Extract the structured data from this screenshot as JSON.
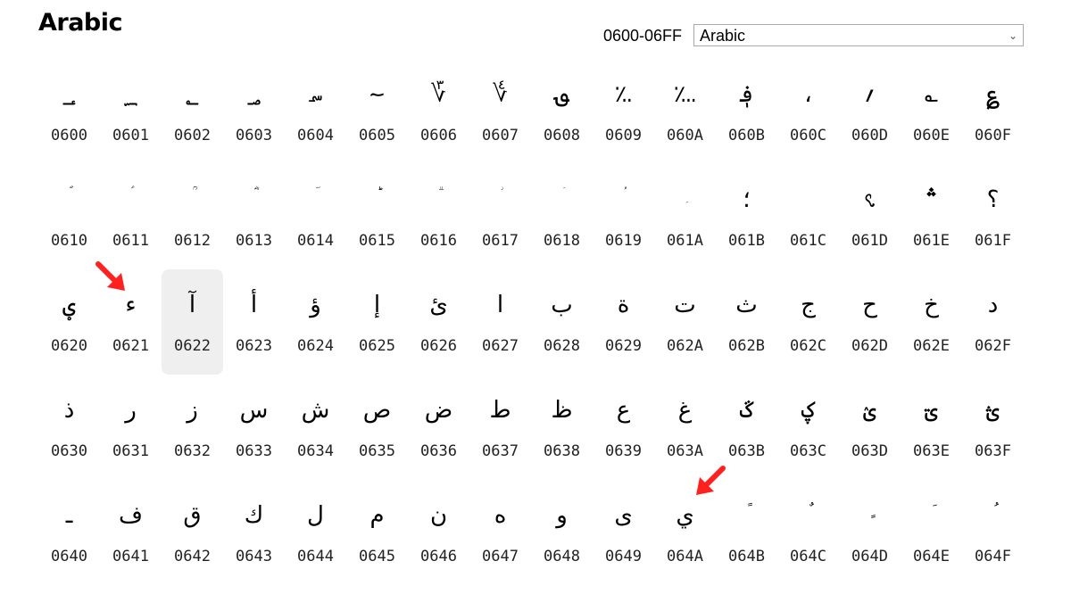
{
  "header": {
    "title": "Arabic",
    "range": "0600-06FF",
    "block_select": {
      "selected": "Arabic"
    }
  },
  "grid": {
    "selected_code": "0622",
    "rows": [
      [
        {
          "ch": "؀",
          "code": "0600"
        },
        {
          "ch": "؁",
          "code": "0601"
        },
        {
          "ch": "؂",
          "code": "0602"
        },
        {
          "ch": "؃",
          "code": "0603"
        },
        {
          "ch": "؄",
          "code": "0604"
        },
        {
          "ch": "؅",
          "code": "0605"
        },
        {
          "ch": "؆",
          "code": "0606"
        },
        {
          "ch": "؇",
          "code": "0607"
        },
        {
          "ch": "؈",
          "code": "0608"
        },
        {
          "ch": "؉",
          "code": "0609"
        },
        {
          "ch": "؊",
          "code": "060A"
        },
        {
          "ch": "؋",
          "code": "060B"
        },
        {
          "ch": "،",
          "code": "060C"
        },
        {
          "ch": "؍",
          "code": "060D"
        },
        {
          "ch": "؎",
          "code": "060E"
        },
        {
          "ch": "؏",
          "code": "060F"
        }
      ],
      [
        {
          "ch": "ؐ",
          "code": "0610",
          "small": true
        },
        {
          "ch": "ؑ",
          "code": "0611",
          "small": true
        },
        {
          "ch": "ؒ",
          "code": "0612",
          "small": true
        },
        {
          "ch": "ؓ",
          "code": "0613",
          "small": true
        },
        {
          "ch": "ؔ",
          "code": "0614",
          "small": true
        },
        {
          "ch": "ؕ",
          "code": "0615",
          "small": true
        },
        {
          "ch": "ؖ",
          "code": "0616",
          "small": true
        },
        {
          "ch": "ؗ",
          "code": "0617",
          "small": true
        },
        {
          "ch": "ؘ",
          "code": "0618",
          "small": true
        },
        {
          "ch": "ؙ",
          "code": "0619",
          "small": true
        },
        {
          "ch": "ؚ",
          "code": "061A",
          "small": true
        },
        {
          "ch": "؛",
          "code": "061B"
        },
        {
          "ch": "",
          "code": "061C"
        },
        {
          "ch": "؝",
          "code": "061D"
        },
        {
          "ch": "؞",
          "code": "061E"
        },
        {
          "ch": "؟",
          "code": "061F"
        }
      ],
      [
        {
          "ch": "ؠ",
          "code": "0620"
        },
        {
          "ch": "ء",
          "code": "0621"
        },
        {
          "ch": "آ",
          "code": "0622"
        },
        {
          "ch": "أ",
          "code": "0623"
        },
        {
          "ch": "ؤ",
          "code": "0624"
        },
        {
          "ch": "إ",
          "code": "0625"
        },
        {
          "ch": "ئ",
          "code": "0626"
        },
        {
          "ch": "ا",
          "code": "0627"
        },
        {
          "ch": "ب",
          "code": "0628"
        },
        {
          "ch": "ة",
          "code": "0629"
        },
        {
          "ch": "ت",
          "code": "062A"
        },
        {
          "ch": "ث",
          "code": "062B"
        },
        {
          "ch": "ج",
          "code": "062C"
        },
        {
          "ch": "ح",
          "code": "062D"
        },
        {
          "ch": "خ",
          "code": "062E"
        },
        {
          "ch": "د",
          "code": "062F"
        }
      ],
      [
        {
          "ch": "ذ",
          "code": "0630"
        },
        {
          "ch": "ر",
          "code": "0631"
        },
        {
          "ch": "ز",
          "code": "0632"
        },
        {
          "ch": "س",
          "code": "0633"
        },
        {
          "ch": "ش",
          "code": "0634"
        },
        {
          "ch": "ص",
          "code": "0635"
        },
        {
          "ch": "ض",
          "code": "0636"
        },
        {
          "ch": "ط",
          "code": "0637"
        },
        {
          "ch": "ظ",
          "code": "0638"
        },
        {
          "ch": "ع",
          "code": "0639"
        },
        {
          "ch": "غ",
          "code": "063A"
        },
        {
          "ch": "ػ",
          "code": "063B"
        },
        {
          "ch": "ؼ",
          "code": "063C"
        },
        {
          "ch": "ؽ",
          "code": "063D"
        },
        {
          "ch": "ؾ",
          "code": "063E"
        },
        {
          "ch": "ؿ",
          "code": "063F"
        }
      ],
      [
        {
          "ch": "ـ",
          "code": "0640"
        },
        {
          "ch": "ف",
          "code": "0641"
        },
        {
          "ch": "ق",
          "code": "0642"
        },
        {
          "ch": "ك",
          "code": "0643"
        },
        {
          "ch": "ل",
          "code": "0644"
        },
        {
          "ch": "م",
          "code": "0645"
        },
        {
          "ch": "ن",
          "code": "0646"
        },
        {
          "ch": "ه",
          "code": "0647"
        },
        {
          "ch": "و",
          "code": "0648"
        },
        {
          "ch": "ى",
          "code": "0649"
        },
        {
          "ch": "ي",
          "code": "064A"
        },
        {
          "ch": "ً",
          "code": "064B",
          "small": true
        },
        {
          "ch": "ٌ",
          "code": "064C",
          "small": true
        },
        {
          "ch": "ٍ",
          "code": "064D",
          "small": true
        },
        {
          "ch": "َ",
          "code": "064E",
          "small": true
        },
        {
          "ch": "ُ",
          "code": "064F",
          "small": true
        }
      ]
    ]
  },
  "annotations": {
    "arrow_color": "#ff2020"
  }
}
